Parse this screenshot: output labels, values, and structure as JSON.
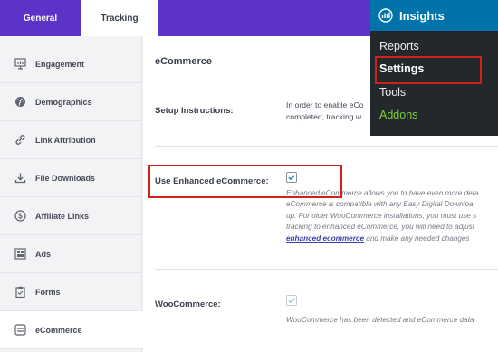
{
  "tabs": {
    "general": "General",
    "tracking": "Tracking"
  },
  "sidebar": {
    "items": [
      {
        "label": "Engagement",
        "icon": "engagement-icon"
      },
      {
        "label": "Demographics",
        "icon": "globe-icon"
      },
      {
        "label": "Link Attribution",
        "icon": "link-icon"
      },
      {
        "label": "File Downloads",
        "icon": "download-icon"
      },
      {
        "label": "Affiliate Links",
        "icon": "dollar-icon"
      },
      {
        "label": "Ads",
        "icon": "ads-icon"
      },
      {
        "label": "Forms",
        "icon": "clipboard-icon"
      },
      {
        "label": "eCommerce",
        "icon": "cart-icon"
      }
    ]
  },
  "main": {
    "title": "eCommerce",
    "setup": {
      "label": "Setup Instructions:",
      "line1": "In order to enable eCo",
      "line2": "completed, tracking w"
    },
    "enhanced": {
      "label": "Use Enhanced eCommerce:",
      "checked": true,
      "help_line1": "Enhanced eCommerce allows you to have even more deta",
      "help_line2": "eCommerce is compatible with any Easy Digital Downloa",
      "help_line3": "up. For older WooCommerce installations, you must use s",
      "help_line4": "tracking to enhanced eCommerce, you will need to adjust",
      "help_link": "enhanced ecommerce",
      "help_line5_rest": " and make any needed changes"
    },
    "woocommerce": {
      "label": "WooCommerce:",
      "checked": true,
      "help": "WooCommerce has been detected and eCommerce data"
    }
  },
  "wp_menu": {
    "title": "Insights",
    "items": [
      "Reports",
      "Settings",
      "Tools",
      "Addons"
    ],
    "current": "Settings"
  },
  "colors": {
    "accent": "#5b33c7",
    "highlight": "#d0221b",
    "wp_menu_bg": "#23282d",
    "wp_header_bg": "#0073aa",
    "addons_green": "#7ad03a"
  }
}
